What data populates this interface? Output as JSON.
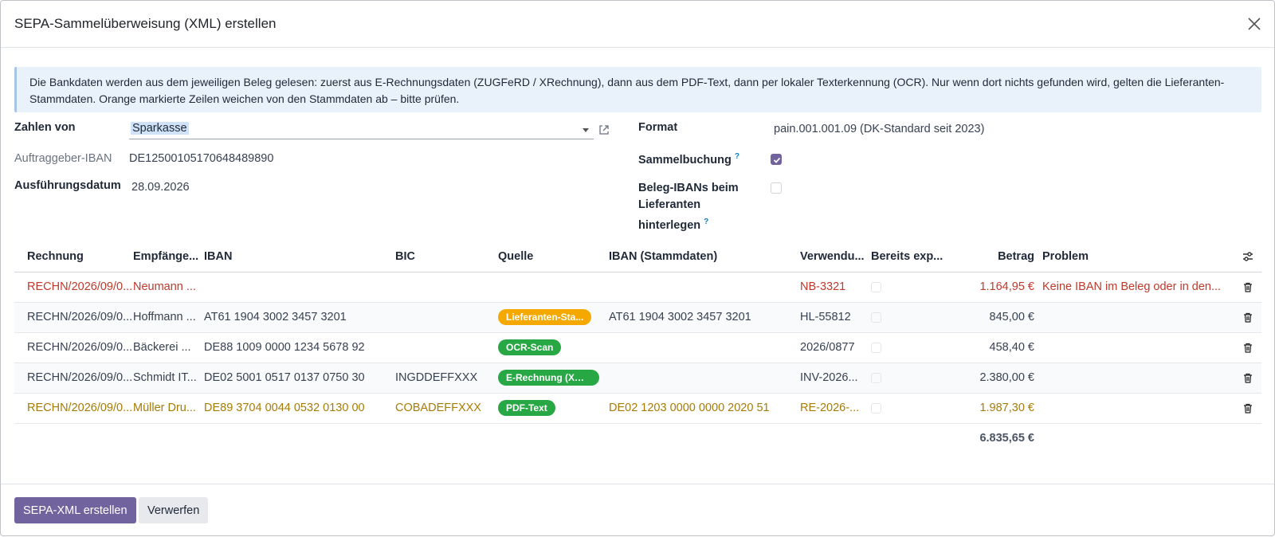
{
  "dialog": {
    "title": "SEPA-Sammelüberweisung (XML) erstellen",
    "info_text": "Die Bankdaten werden aus dem jeweiligen Beleg gelesen: zuerst aus E-Rechnungsdaten (ZUGFeRD / XRechnung), dann aus dem PDF-Text, dann per lokaler Texterkennung (OCR). Nur wenn dort nichts gefunden wird, gelten die Lieferanten-Stammdaten. Orange markierte Zeilen weichen von den Stammdaten ab – bitte prüfen."
  },
  "form": {
    "zahlen_von_label": "Zahlen von",
    "zahlen_von_value": "Sparkasse",
    "auftraggeber_iban_label": "Auftraggeber-IBAN",
    "auftraggeber_iban_value": "DE12500105170648489890",
    "ausfuehrungsdatum_label": "Ausführungsdatum",
    "ausfuehrungsdatum_value": "28.09.2026",
    "format_label": "Format",
    "format_value": "pain.001.001.09 (DK-Standard seit 2023)",
    "sammelbuchung_label": "Sammelbuchung",
    "sammelbuchung_checked": true,
    "beleg_ibans_label_1": "Beleg-IBANs beim",
    "beleg_ibans_label_2": "Lieferanten",
    "beleg_ibans_label_3": "hinterlegen",
    "beleg_ibans_checked": false,
    "help_mark": "?"
  },
  "table": {
    "headers": [
      "Rechnung",
      "Empfänge...",
      "IBAN",
      "BIC",
      "Quelle",
      "IBAN (Stammdaten)",
      "Verwendu...",
      "Bereits exp...",
      "Betrag",
      "Problem"
    ],
    "rows": [
      {
        "rechnung": "RECHN/2026/09/0...",
        "empfaenger": "Neumann ...",
        "iban": "",
        "bic": "",
        "quelle": "",
        "iban_stamm": "",
        "verwendung": "NB-3321",
        "betrag": "1.164,95 €",
        "problem": "Keine IBAN im Beleg oder in den..."
      },
      {
        "rechnung": "RECHN/2026/09/0...",
        "empfaenger": "Hoffmann ...",
        "iban": "AT61 1904 3002 3457 3201",
        "bic": "",
        "quelle": "Lieferanten-Sta...",
        "iban_stamm": "AT61 1904 3002 3457 3201",
        "verwendung": "HL-55812",
        "betrag": "845,00 €",
        "problem": ""
      },
      {
        "rechnung": "RECHN/2026/09/0...",
        "empfaenger": "Bäckerei ...",
        "iban": "DE88 1009 0000 1234 5678 92",
        "bic": "",
        "quelle": "OCR-Scan",
        "iban_stamm": "",
        "verwendung": "2026/0877",
        "betrag": "458,40 €",
        "problem": ""
      },
      {
        "rechnung": "RECHN/2026/09/0...",
        "empfaenger": "Schmidt IT...",
        "iban": "DE02 5001 0517 0137 0750 30",
        "bic": "INGDDEFFXXX",
        "quelle": "E-Rechnung (XML)",
        "iban_stamm": "",
        "verwendung": "INV-2026...",
        "betrag": "2.380,00 €",
        "problem": ""
      },
      {
        "rechnung": "RECHN/2026/09/0...",
        "empfaenger": "Müller Dru...",
        "iban": "DE89 3704 0044 0532 0130 00",
        "bic": "COBADEFFXXX",
        "quelle": "PDF-Text",
        "iban_stamm": "DE02 1203 0000 0000 2020 51",
        "verwendung": "RE-2026-...",
        "betrag": "1.987,30 €",
        "problem": ""
      }
    ],
    "total": "6.835,65 €"
  },
  "badge_colors": {
    "Lieferanten-Sta...": "#f5a800",
    "OCR-Scan": "#28a745",
    "E-Rechnung (XML)": "#28a745",
    "PDF-Text": "#28a745"
  },
  "colors": {
    "primary": "#71639e",
    "error_row": "#c0392b",
    "warning_row": "#a67b05"
  },
  "footer": {
    "create_label": "SEPA-XML erstellen",
    "discard_label": "Verwerfen"
  }
}
